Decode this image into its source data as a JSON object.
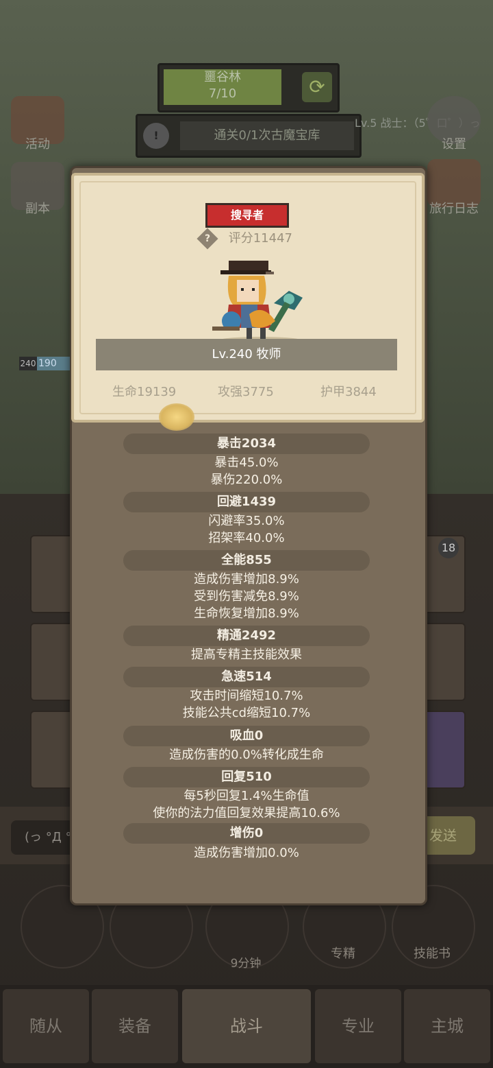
{
  "top_hud": {
    "map_name": "噩谷林",
    "map_progress": "7/10",
    "quest_text": "通关0/1次古魔宝库",
    "player_tag": "Lv.5 战士：（5゜口゜）っ"
  },
  "side_menu": {
    "activity_label": "活动",
    "dungeon_label": "副本",
    "settings_label": "设置",
    "journal_label": "旅行日志"
  },
  "hero_hp_level": "240",
  "hero_hp_partial": "190",
  "popup": {
    "role_badge": "搜寻者",
    "score_icon": "?",
    "score_label": "评分11447",
    "level_class": "Lv.240 牧师",
    "base_stats": [
      {
        "label": "生命19139"
      },
      {
        "label": "攻强3775"
      },
      {
        "label": "护甲3844"
      }
    ],
    "stat_groups": [
      {
        "header": "暴击2034",
        "lines": [
          "暴击45.0%",
          "暴伤220.0%"
        ]
      },
      {
        "header": "回避1439",
        "lines": [
          "闪避率35.0%",
          "招架率40.0%"
        ]
      },
      {
        "header": "全能855",
        "lines": [
          "造成伤害增加8.9%",
          "受到伤害减免8.9%",
          "生命恢复增加8.9%"
        ]
      },
      {
        "header": "精通2492",
        "lines": [
          "提高专精主技能效果"
        ]
      },
      {
        "header": "急速514",
        "lines": [
          "攻击时间缩短10.7%",
          "技能公共cd缩短10.7%"
        ]
      },
      {
        "header": "吸血0",
        "lines": [
          "造成伤害的0.0%转化成生命"
        ]
      },
      {
        "header": "回复510",
        "lines": [
          "每5秒回复1.4%生命值",
          "使你的法力值回复效果提高10.6%"
        ]
      },
      {
        "header": "增伤0",
        "lines": [
          "造成伤害增加0.0%"
        ]
      }
    ]
  },
  "slot_badge": "18",
  "chat": {
    "input_text": "(っ °Д °",
    "send_label": "发送"
  },
  "action_buttons": {
    "chest_timer": "9分钟",
    "spec_label": "专精",
    "skillbook_label": "技能书"
  },
  "bottom_nav": {
    "tabs": [
      "随从",
      "装备",
      "战斗",
      "专业",
      "主城"
    ],
    "active": "战斗"
  }
}
